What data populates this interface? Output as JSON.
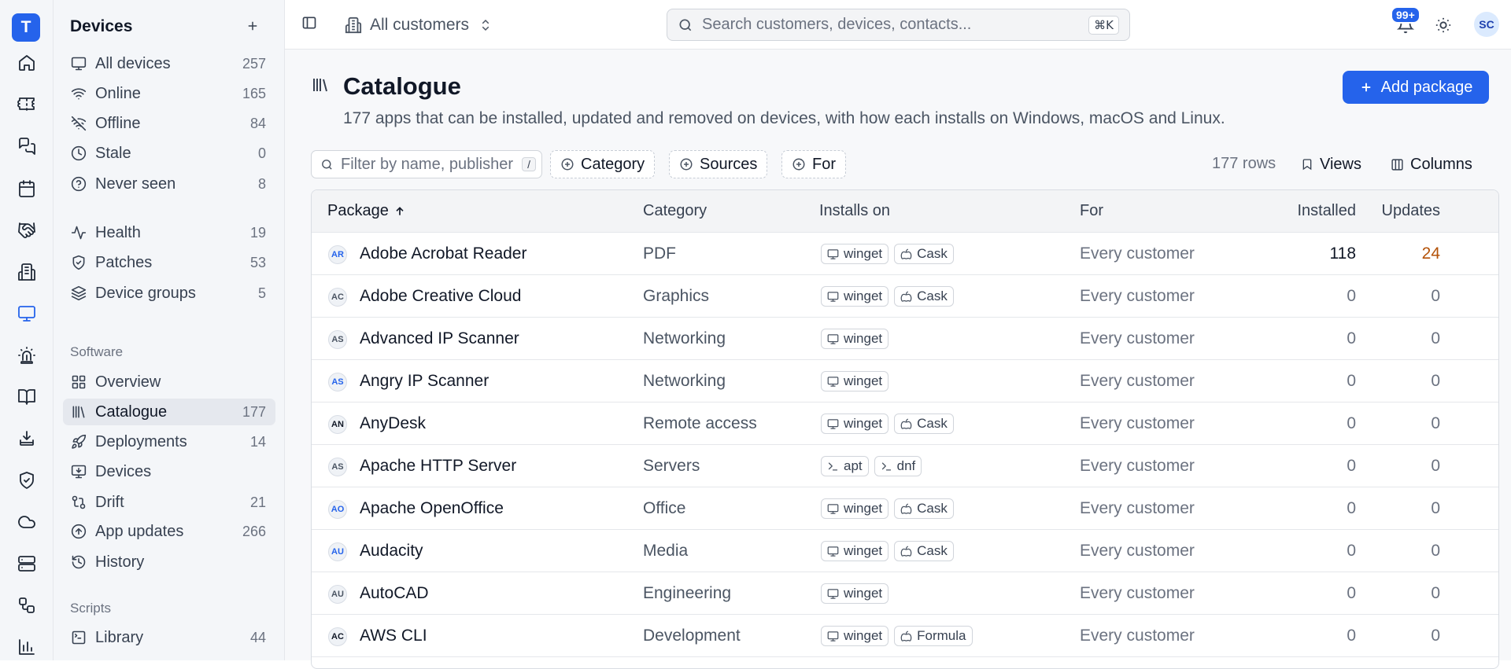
{
  "app": {
    "logo_letter": "T",
    "accent": "#2563eb"
  },
  "rail": {
    "icons": [
      "home-icon",
      "ticket-icon",
      "chat-icon",
      "calendar-icon",
      "handshake-icon",
      "building-icon",
      "monitor-icon",
      "alarm-icon",
      "book-icon",
      "download-tray-icon",
      "shield-check-icon",
      "cloud-icon",
      "server-icon",
      "workflow-icon",
      "chart-icon"
    ],
    "active": "monitor-icon"
  },
  "sidebar": {
    "title": "Devices",
    "groups": [
      {
        "items": [
          {
            "label": "All devices",
            "count": "257",
            "icon": "monitor-icon"
          },
          {
            "label": "Online",
            "count": "165",
            "icon": "wifi-icon"
          },
          {
            "label": "Offline",
            "count": "84",
            "icon": "wifi-off-icon"
          },
          {
            "label": "Stale",
            "count": "0",
            "icon": "clock-icon"
          },
          {
            "label": "Never seen",
            "count": "8",
            "icon": "help-circle-icon"
          }
        ]
      },
      {
        "items": [
          {
            "label": "Health",
            "count": "19",
            "icon": "pulse-icon"
          },
          {
            "label": "Patches",
            "count": "53",
            "icon": "shield-icon"
          },
          {
            "label": "Device groups",
            "count": "5",
            "icon": "layers-icon"
          }
        ]
      }
    ],
    "software_label": "Software",
    "software_items": [
      {
        "label": "Overview",
        "count": "",
        "icon": "grid-icon"
      },
      {
        "label": "Catalogue",
        "count": "177",
        "icon": "library-icon",
        "active": true
      },
      {
        "label": "Deployments",
        "count": "14",
        "icon": "rocket-icon"
      },
      {
        "label": "Devices",
        "count": "",
        "icon": "monitor-download-icon"
      },
      {
        "label": "Drift",
        "count": "21",
        "icon": "git-compare-icon"
      },
      {
        "label": "App updates",
        "count": "266",
        "icon": "arrow-up-circle-icon"
      },
      {
        "label": "History",
        "count": "",
        "icon": "history-icon"
      }
    ],
    "scripts_label": "Scripts",
    "scripts_items": [
      {
        "label": "Library",
        "count": "44",
        "icon": "terminal-square-icon"
      }
    ]
  },
  "topbar": {
    "customer": "All customers",
    "search_placeholder": "Search customers, devices, contacts...",
    "search_shortcut": "⌘K",
    "notifications": "99+",
    "avatar": "SC"
  },
  "page": {
    "title": "Catalogue",
    "subtitle": "177 apps that can be installed, updated and removed on devices, with how each installs on Windows, macOS and Linux.",
    "add_button": "Add package",
    "filter_placeholder": "Filter by name, publisher",
    "filter_shortcut": "/",
    "chips": [
      "Category",
      "Sources",
      "For"
    ],
    "rows_count": "177 rows",
    "views_label": "Views",
    "columns_label": "Columns"
  },
  "table": {
    "columns": {
      "package": "Package",
      "category": "Category",
      "installs_on": "Installs on",
      "for": "For",
      "installed": "Installed",
      "updates": "Updates"
    },
    "rows": [
      {
        "initials": "AR",
        "initials_color": "#2563eb",
        "name": "Adobe Acrobat Reader",
        "category": "PDF",
        "sources": [
          {
            "label": "winget",
            "icon": "monitor-icon"
          },
          {
            "label": "Cask",
            "icon": "apple-icon"
          }
        ],
        "for": "Every customer",
        "installed": "118",
        "updates": "24",
        "updates_color": "#b45309",
        "installed_color": "#111827"
      },
      {
        "initials": "AC",
        "initials_color": "#4b5563",
        "name": "Adobe Creative Cloud",
        "category": "Graphics",
        "sources": [
          {
            "label": "winget",
            "icon": "monitor-icon"
          },
          {
            "label": "Cask",
            "icon": "apple-icon"
          }
        ],
        "for": "Every customer",
        "installed": "0",
        "updates": "0"
      },
      {
        "initials": "AS",
        "initials_color": "#4b5563",
        "name": "Advanced IP Scanner",
        "category": "Networking",
        "sources": [
          {
            "label": "winget",
            "icon": "monitor-icon"
          }
        ],
        "for": "Every customer",
        "installed": "0",
        "updates": "0"
      },
      {
        "initials": "AS",
        "initials_color": "#2563eb",
        "name": "Angry IP Scanner",
        "category": "Networking",
        "sources": [
          {
            "label": "winget",
            "icon": "monitor-icon"
          }
        ],
        "for": "Every customer",
        "installed": "0",
        "updates": "0"
      },
      {
        "initials": "AN",
        "initials_color": "#111827",
        "name": "AnyDesk",
        "category": "Remote access",
        "sources": [
          {
            "label": "winget",
            "icon": "monitor-icon"
          },
          {
            "label": "Cask",
            "icon": "apple-icon"
          }
        ],
        "for": "Every customer",
        "installed": "0",
        "updates": "0"
      },
      {
        "initials": "AS",
        "initials_color": "#4b5563",
        "name": "Apache HTTP Server",
        "category": "Servers",
        "sources": [
          {
            "label": "apt",
            "icon": "terminal-icon"
          },
          {
            "label": "dnf",
            "icon": "terminal-icon"
          }
        ],
        "for": "Every customer",
        "installed": "0",
        "updates": "0"
      },
      {
        "initials": "AO",
        "initials_color": "#2563eb",
        "name": "Apache OpenOffice",
        "category": "Office",
        "sources": [
          {
            "label": "winget",
            "icon": "monitor-icon"
          },
          {
            "label": "Cask",
            "icon": "apple-icon"
          }
        ],
        "for": "Every customer",
        "installed": "0",
        "updates": "0"
      },
      {
        "initials": "AU",
        "initials_color": "#2563eb",
        "name": "Audacity",
        "category": "Media",
        "sources": [
          {
            "label": "winget",
            "icon": "monitor-icon"
          },
          {
            "label": "Cask",
            "icon": "apple-icon"
          }
        ],
        "for": "Every customer",
        "installed": "0",
        "updates": "0"
      },
      {
        "initials": "AU",
        "initials_color": "#4b5563",
        "name": "AutoCAD",
        "category": "Engineering",
        "sources": [
          {
            "label": "winget",
            "icon": "monitor-icon"
          }
        ],
        "for": "Every customer",
        "installed": "0",
        "updates": "0"
      },
      {
        "initials": "AC",
        "initials_color": "#111827",
        "name": "AWS CLI",
        "category": "Development",
        "sources": [
          {
            "label": "winget",
            "icon": "monitor-icon"
          },
          {
            "label": "Formula",
            "icon": "apple-icon"
          }
        ],
        "for": "Every customer",
        "installed": "0",
        "updates": "0"
      }
    ]
  }
}
